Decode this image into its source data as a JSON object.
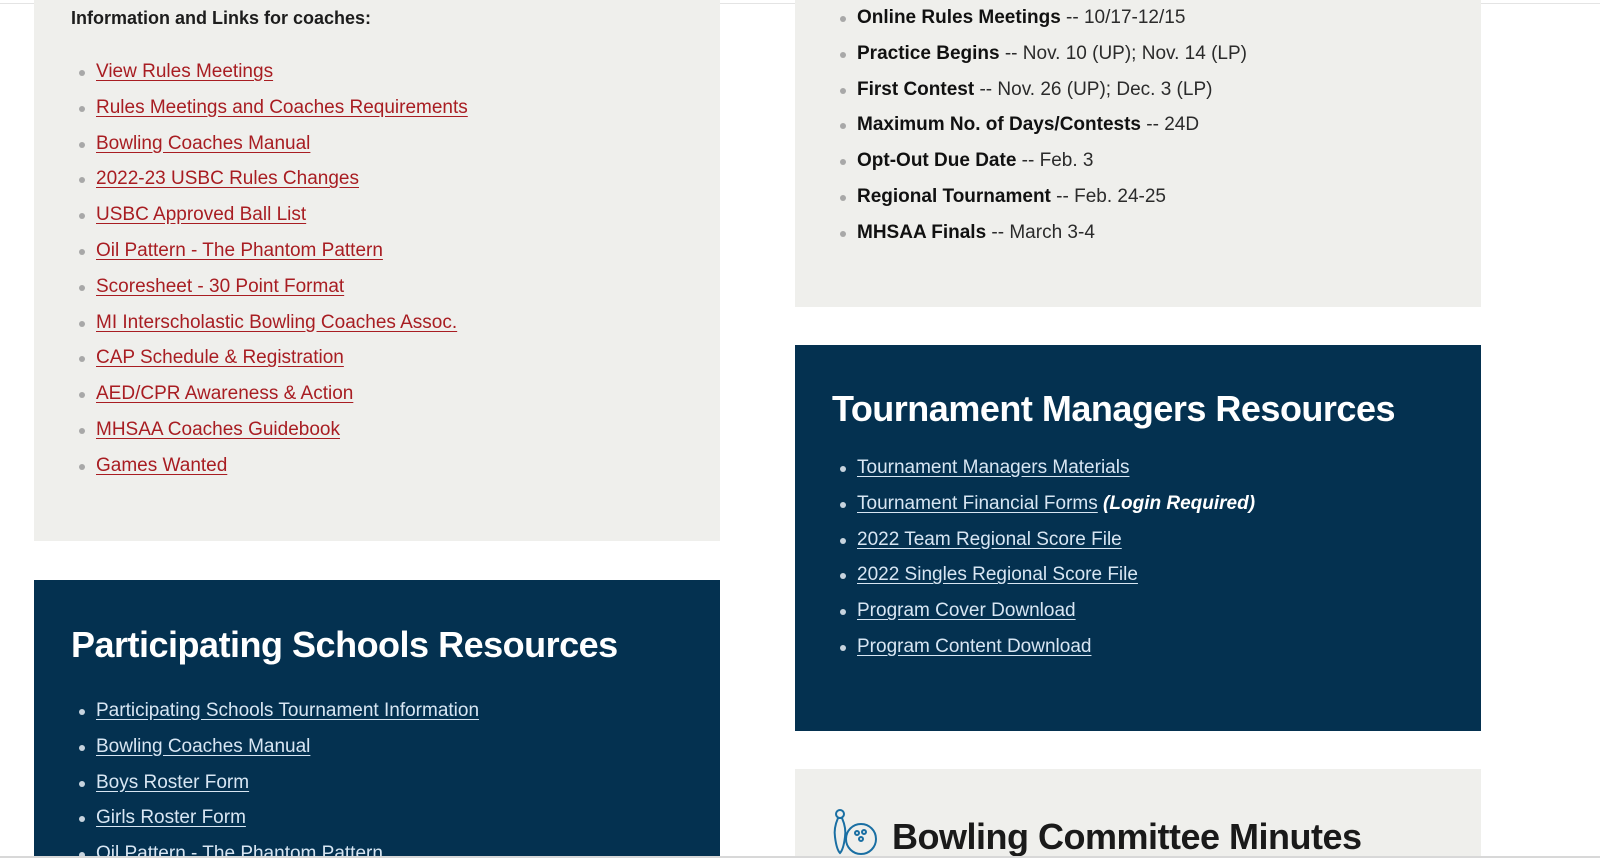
{
  "coaches": {
    "intro": "Information and Links for coaches:",
    "links": [
      "View Rules Meetings",
      "Rules Meetings and Coaches Requirements",
      "Bowling Coaches Manual",
      "2022-23 USBC Rules Changes",
      "USBC Approved Ball List",
      "Oil Pattern - The Phantom Pattern",
      "Scoresheet - 30 Point Format",
      "MI Interscholastic Bowling Coaches Assoc.",
      "CAP Schedule & Registration",
      "AED/CPR Awareness & Action",
      "MHSAA Coaches Guidebook",
      "Games Wanted"
    ]
  },
  "dates": [
    {
      "label": "Online Rules Meetings",
      "value": " -- 10/17-12/15"
    },
    {
      "label": "Practice Begins",
      "value": " -- Nov. 10 (UP); Nov. 14 (LP)"
    },
    {
      "label": "First Contest",
      "value": " -- Nov. 26 (UP); Dec. 3 (LP)"
    },
    {
      "label": "Maximum No. of Days/Contests",
      "value": " -- 24D"
    },
    {
      "label": "Opt-Out Due Date",
      "value": " -- Feb. 3"
    },
    {
      "label": "Regional Tournament",
      "value": " -- Feb. 24-25"
    },
    {
      "label": "MHSAA Finals",
      "value": " -- March 3-4"
    }
  ],
  "tournament_managers": {
    "title": "Tournament Managers Resources",
    "links": [
      "Tournament Managers Materials",
      "Tournament Financial Forms",
      "2022 Team Regional Score File",
      "2022 Singles Regional Score File",
      "Program Cover Download",
      "Program Content Download"
    ],
    "login_note": "(Login Required)"
  },
  "participating_schools": {
    "title": "Participating Schools Resources",
    "links": [
      "Participating Schools Tournament Information",
      "Bowling Coaches Manual",
      "Boys Roster Form",
      "Girls Roster Form",
      "Oil Pattern - The Phantom Pattern"
    ]
  },
  "committee": {
    "title": "Bowling Committee Minutes",
    "icon": "bowling-icon"
  },
  "colors": {
    "navy": "#043150",
    "gray_panel": "#efefec",
    "link_red": "#a81d22"
  }
}
